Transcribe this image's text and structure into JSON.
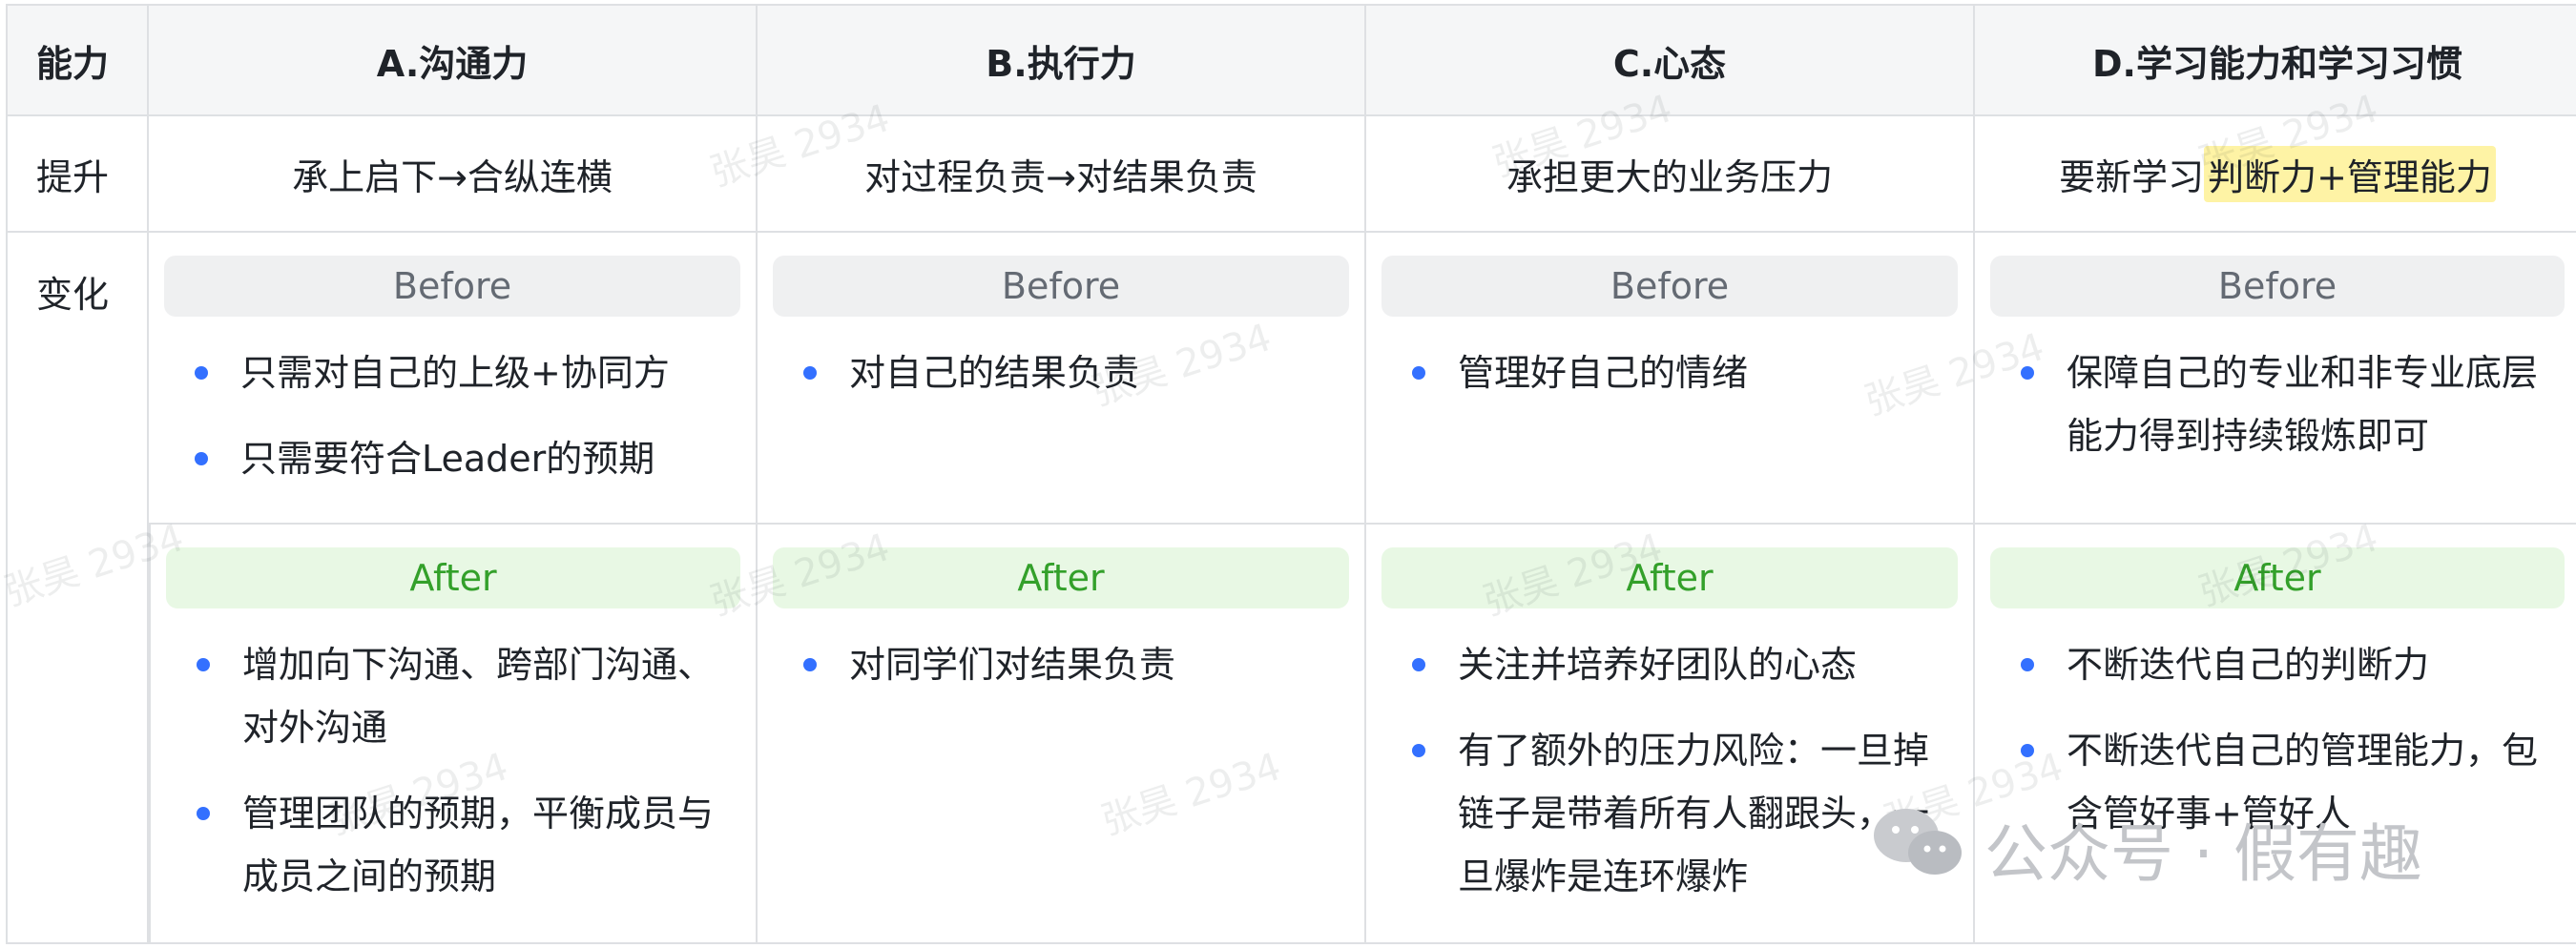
{
  "table": {
    "header": {
      "label": "能力",
      "cols": [
        "A.沟通力",
        "B.执行力",
        "C.心态",
        "D.学习能力和学习习惯"
      ]
    },
    "lift": {
      "label": "提升",
      "cols": [
        {
          "text": "承上启下→合纵连横"
        },
        {
          "text": "对过程负责→对结果负责"
        },
        {
          "text": "承担更大的业务压力"
        },
        {
          "prefix": "要新学习 ",
          "highlight": "判断力+管理能力"
        }
      ]
    },
    "change": {
      "label": "变化",
      "before_label": "Before",
      "after_label": "After",
      "cols": [
        {
          "before": [
            "只需对自己的上级+协同方",
            "只需要符合Leader的预期"
          ],
          "after": [
            "增加向下沟通、跨部门沟通、对外沟通",
            "管理团队的预期，平衡成员与成员之间的预期"
          ]
        },
        {
          "before": [
            "对自己的结果负责"
          ],
          "after": [
            "对同学们对结果负责"
          ]
        },
        {
          "before": [
            "管理好自己的情绪"
          ],
          "after": [
            "关注并培养好团队的心态",
            "有了额外的压力风险：一旦掉链子是带着所有人翻跟头，一旦爆炸是连环爆炸"
          ]
        },
        {
          "before": [
            "保障自己的专业和非专业底层能力得到持续锻炼即可"
          ],
          "after": [
            "不断迭代自己的判断力",
            "不断迭代自己的管理能力，包含管好事+管好人"
          ]
        }
      ]
    }
  },
  "watermark": "张昊 2934",
  "brand": {
    "icon": "wechat-icon",
    "text": "公众号 · 假有趣"
  },
  "colors": {
    "bullet": "#3370ff",
    "after_text": "#33a02a",
    "after_bg": "#e8f8e4",
    "before_bg": "#eff0f1",
    "highlight": "#fef3a5"
  }
}
